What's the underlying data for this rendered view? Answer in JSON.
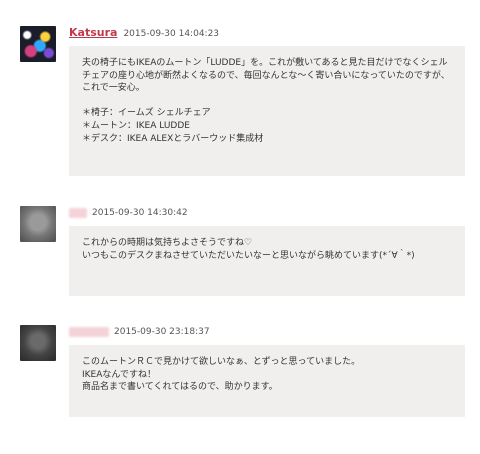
{
  "comments": [
    {
      "author": "Katsura",
      "date": "2015-09-30 14:04:23",
      "body": "夫の椅子にもIKEAのムートン「LUDDE」を。これが敷いてあると見た目だけでなくシェルチェアの座り心地が断然よくなるので、毎回なんとな〜く寄い合いになっていたのですが、これで一安心。\n\n＊椅子：イームズ シェルチェア\n＊ムートン：IKEA LUDDE\n＊デスク：IKEA ALEXとラバーウッド集成材"
    },
    {
      "author": "",
      "date": "2015-09-30 14:30:42",
      "body": "これからの時期は気持ちよさそうですね♡\nいつもこのデスクまねさせていただいたいなーと思いながら眺めています(*´∀｀*)"
    },
    {
      "author": "",
      "date": "2015-09-30 23:18:37",
      "body": "このムートンＲＣで見かけて欲しいなぁ、とずっと思っていました。\nIKEAなんですね！\n商品名まで書いてくれてはるので、助かります。"
    }
  ]
}
